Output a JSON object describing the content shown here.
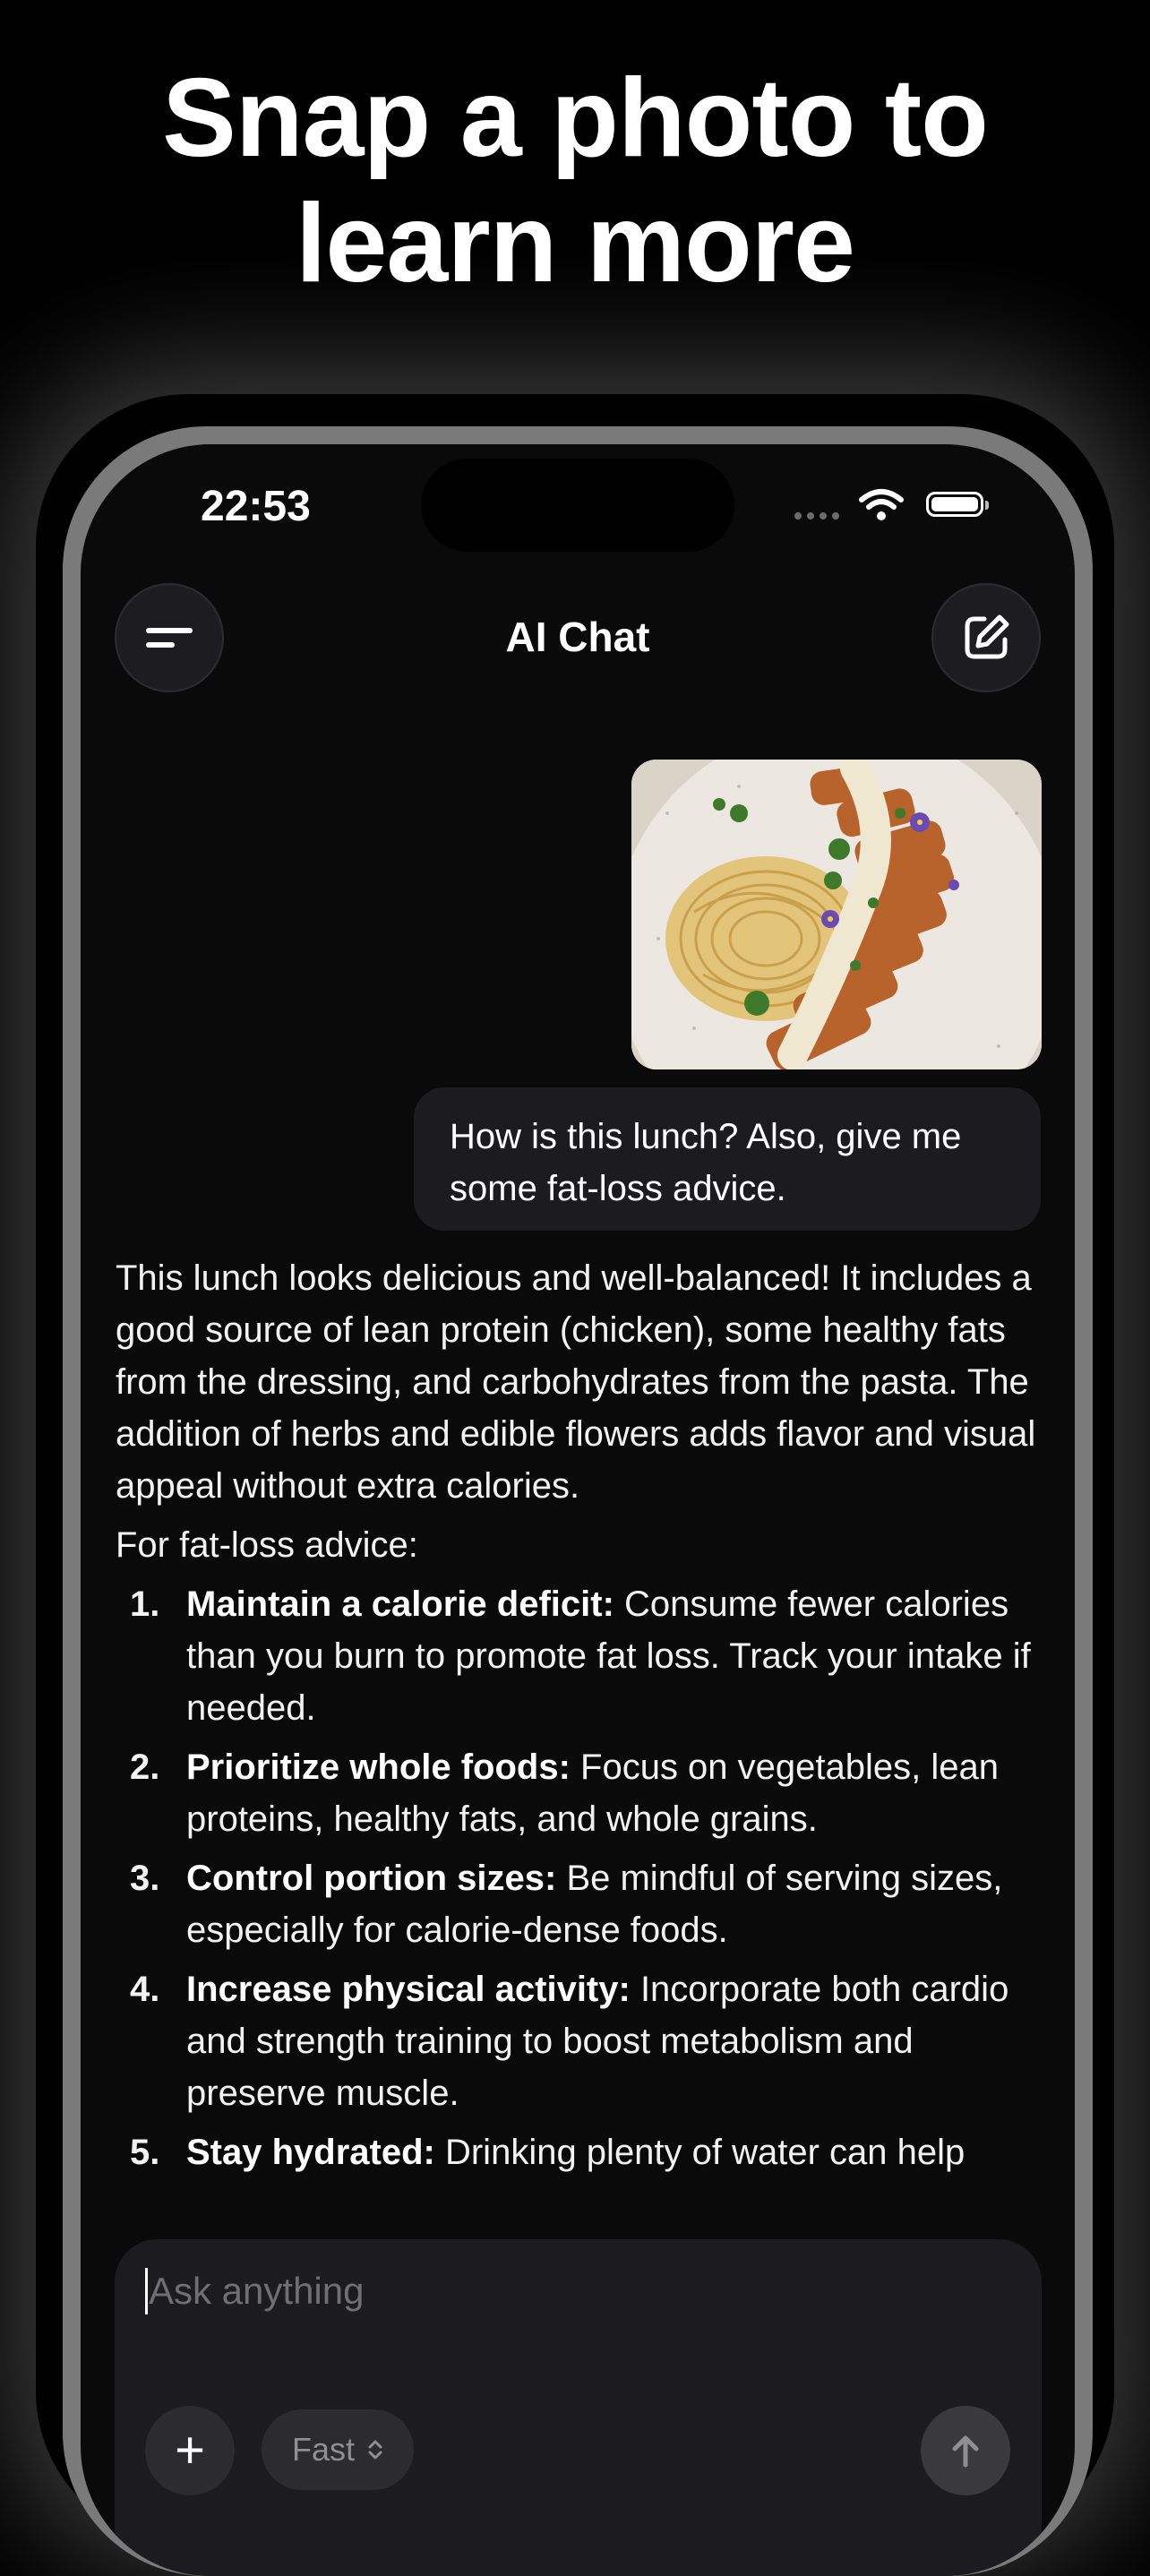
{
  "promo": {
    "headline_line1": "Snap a photo to",
    "headline_line2": "learn more"
  },
  "status_bar": {
    "time": "22:53",
    "icons": [
      "signal-dots-icon",
      "wifi-icon",
      "battery-icon"
    ]
  },
  "nav": {
    "title": "AI Chat",
    "left_icon": "menu-icon",
    "right_icon": "new-chat-icon"
  },
  "conversation": {
    "user_image_alt": "Photo of pasta with sliced breaded chicken, creamy dressing, herbs and edible flowers",
    "user_message": "How is this lunch? Also, give me some fat-loss advice.",
    "ai_intro": "This lunch looks delicious and well-balanced! It includes a good source of lean protein (chicken), some healthy fats from the dressing, and carbohydrates from the pasta. The addition of herbs and edible flowers adds flavor and visual appeal without extra calories.",
    "ai_advice_heading": "For fat-loss advice:",
    "ai_advice": [
      {
        "num": "1.",
        "title": "Maintain a calorie deficit:",
        "text": " Consume fewer calories than you burn to promote fat loss. Track your intake if needed."
      },
      {
        "num": "2.",
        "title": "Prioritize whole foods:",
        "text": " Focus on vegetables, lean proteins, healthy fats, and whole grains."
      },
      {
        "num": "3.",
        "title": "Control portion sizes:",
        "text": " Be mindful of serving sizes, especially for calorie-dense foods."
      },
      {
        "num": "4.",
        "title": "Increase physical activity:",
        "text": " Incorporate both cardio and strength training to boost metabolism and preserve muscle."
      },
      {
        "num": "5.",
        "title": "Stay hydrated:",
        "text": " Drinking plenty of water can help"
      }
    ]
  },
  "composer": {
    "placeholder": "Ask anything",
    "value": "",
    "add_label": "+",
    "mode_label": "Fast",
    "mode_icon": "chevron-up-down-icon",
    "send_icon": "arrow-up-icon"
  },
  "colors": {
    "background": "#000000",
    "screen": "#0a0a0a",
    "bubble": "#1c1c1e",
    "muted": "#8e8e93"
  }
}
